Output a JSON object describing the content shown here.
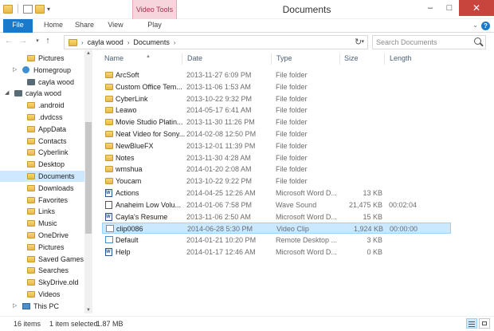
{
  "window": {
    "title": "Documents",
    "contextual_tab": "Video Tools",
    "minimize": "–",
    "maximize": "□",
    "close": "✕"
  },
  "ribbon": {
    "tabs": [
      "File",
      "Home",
      "Share",
      "View",
      "Play"
    ],
    "expand_toggle": "⌄",
    "help": "?"
  },
  "address": {
    "crumbs": [
      "cayla wood",
      "Documents"
    ],
    "search_placeholder": "Search Documents"
  },
  "nav_pane": {
    "items": [
      {
        "label": "Pictures",
        "icon": "folder-icon"
      },
      {
        "label": "Homegroup",
        "icon": "homegroup-icon"
      },
      {
        "label": "cayla wood",
        "icon": "user-icon"
      },
      {
        "label": "cayla wood",
        "icon": "user-icon"
      },
      {
        "label": ".android",
        "icon": "folder-icon"
      },
      {
        "label": ".dvdcss",
        "icon": "folder-icon"
      },
      {
        "label": "AppData",
        "icon": "folder-icon"
      },
      {
        "label": "Contacts",
        "icon": "folder-icon"
      },
      {
        "label": "Cyberlink",
        "icon": "folder-icon"
      },
      {
        "label": "Desktop",
        "icon": "folder-icon"
      },
      {
        "label": "Documents",
        "icon": "folder-icon",
        "selected": true
      },
      {
        "label": "Downloads",
        "icon": "folder-icon"
      },
      {
        "label": "Favorites",
        "icon": "folder-icon"
      },
      {
        "label": "Links",
        "icon": "folder-icon"
      },
      {
        "label": "Music",
        "icon": "folder-icon"
      },
      {
        "label": "OneDrive",
        "icon": "folder-icon"
      },
      {
        "label": "Pictures",
        "icon": "folder-icon"
      },
      {
        "label": "Saved Games",
        "icon": "folder-icon"
      },
      {
        "label": "Searches",
        "icon": "folder-icon"
      },
      {
        "label": "SkyDrive.old",
        "icon": "folder-icon"
      },
      {
        "label": "Videos",
        "icon": "folder-icon"
      },
      {
        "label": "This PC",
        "icon": "computer-icon"
      }
    ]
  },
  "columns": [
    "Name",
    "Date",
    "Type",
    "Size",
    "Length"
  ],
  "files": [
    {
      "name": "ArcSoft",
      "date": "2013-11-27 6:09 PM",
      "type": "File folder",
      "size": "",
      "length": "",
      "icon": "folder-icon"
    },
    {
      "name": "Custom Office Tem...",
      "date": "2013-11-06 1:53 AM",
      "type": "File folder",
      "size": "",
      "length": "",
      "icon": "folder-icon"
    },
    {
      "name": "CyberLink",
      "date": "2013-10-22 9:32 PM",
      "type": "File folder",
      "size": "",
      "length": "",
      "icon": "folder-icon"
    },
    {
      "name": "Leawo",
      "date": "2014-05-17 6:41 AM",
      "type": "File folder",
      "size": "",
      "length": "",
      "icon": "folder-icon"
    },
    {
      "name": "Movie Studio Platin...",
      "date": "2013-11-30 11:26 PM",
      "type": "File folder",
      "size": "",
      "length": "",
      "icon": "folder-icon"
    },
    {
      "name": "Neat Video for Sony...",
      "date": "2014-02-08 12:50 PM",
      "type": "File folder",
      "size": "",
      "length": "",
      "icon": "folder-icon"
    },
    {
      "name": "NewBlueFX",
      "date": "2013-12-01 11:39 PM",
      "type": "File folder",
      "size": "",
      "length": "",
      "icon": "folder-icon"
    },
    {
      "name": "Notes",
      "date": "2013-11-30 4:28 AM",
      "type": "File folder",
      "size": "",
      "length": "",
      "icon": "folder-icon"
    },
    {
      "name": "wmshua",
      "date": "2014-01-20 2:08 AM",
      "type": "File folder",
      "size": "",
      "length": "",
      "icon": "folder-icon"
    },
    {
      "name": "Youcam",
      "date": "2013-10-22 9:22 PM",
      "type": "File folder",
      "size": "",
      "length": "",
      "icon": "folder-icon"
    },
    {
      "name": "Actions",
      "date": "2014-04-25 12:26 AM",
      "type": "Microsoft Word D...",
      "size": "13 KB",
      "length": "",
      "icon": "word-document-icon"
    },
    {
      "name": "Anaheim Low Volu...",
      "date": "2014-01-06 7:58 PM",
      "type": "Wave Sound",
      "size": "21,475 KB",
      "length": "00:02:04",
      "icon": "audio-file-icon"
    },
    {
      "name": "Cayla's Resume",
      "date": "2013-11-06 2:50 AM",
      "type": "Microsoft Word D...",
      "size": "15 KB",
      "length": "",
      "icon": "word-document-icon"
    },
    {
      "name": "clip0086",
      "date": "2014-06-28 5:30 PM",
      "type": "Video Clip",
      "size": "1,924 KB",
      "length": "00:00:00",
      "icon": "video-file-icon",
      "selected": true
    },
    {
      "name": "Default",
      "date": "2014-01-21 10:20 PM",
      "type": "Remote Desktop ...",
      "size": "3 KB",
      "length": "",
      "icon": "remote-desktop-icon"
    },
    {
      "name": "Help",
      "date": "2014-01-17 12:46 AM",
      "type": "Microsoft Word D...",
      "size": "0 KB",
      "length": "",
      "icon": "word-document-icon"
    }
  ],
  "status": {
    "item_count": "16 items",
    "selection": "1 item selected",
    "selection_size": "1.87 MB"
  },
  "colors": {
    "file_tab": "#1979ca",
    "context_tab": "#f7d5dc",
    "selection": "#cce8ff",
    "close_button": "#c7453c"
  }
}
